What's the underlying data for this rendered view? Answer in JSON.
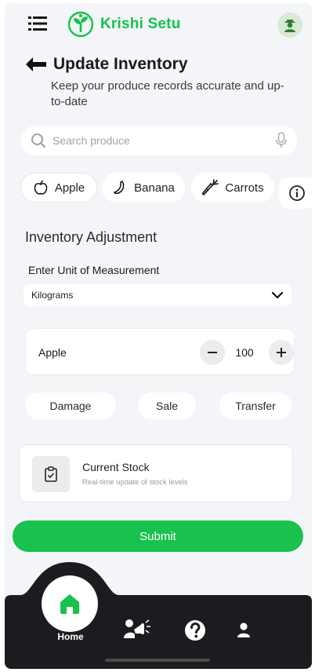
{
  "app": {
    "name": "Krishi Setu",
    "brand_color": "#17c24a"
  },
  "header": {
    "menu_icon": "hamburger-menu-icon",
    "logo_icon": "sprout-logo-icon",
    "avatar_icon": "farmer-avatar-icon"
  },
  "page": {
    "title": "Update Inventory",
    "subtitle": "Keep your produce records accurate and up-to-date"
  },
  "search": {
    "placeholder": "Search produce",
    "left_icon": "search-icon",
    "right_icon": "microphone-icon"
  },
  "produce_chips": [
    {
      "label": "Apple",
      "icon": "apple-icon"
    },
    {
      "label": "Banana",
      "icon": "banana-icon"
    },
    {
      "label": "Carrots",
      "icon": "carrot-icon"
    }
  ],
  "adjustment": {
    "section_title": "Inventory Adjustment",
    "unit_label": "Enter Unit of Measurement",
    "unit_value": "Kilograms",
    "item_name": "Apple",
    "quantity": "100",
    "reasons": [
      "Damage",
      "Sale",
      "Transfer"
    ]
  },
  "stock": {
    "title": "Current Stock",
    "subtitle": "Real-time update of stock levels",
    "icon": "clipboard-check-icon"
  },
  "submit_label": "Submit",
  "nav": {
    "home_label": "Home",
    "items": [
      "home-icon",
      "announcement-icon",
      "help-icon",
      "profile-icon"
    ]
  }
}
